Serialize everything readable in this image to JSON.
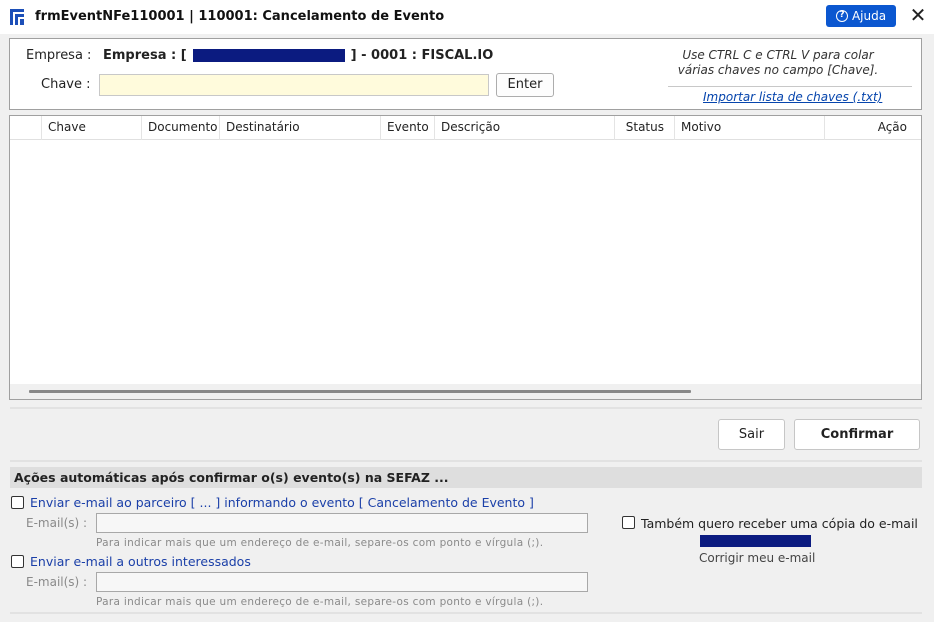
{
  "window": {
    "title": "frmEventNFe110001 | 110001: Cancelamento de Evento",
    "help_label": "Ajuda",
    "close_glyph": "✕"
  },
  "header": {
    "empresa_label": "Empresa :",
    "empresa_prefix": "Empresa : [",
    "empresa_suffix": "] - 0001 : FISCAL.IO",
    "chave_label": "Chave :",
    "chave_value": "",
    "enter_label": "Enter",
    "hint_text": "Use CTRL C e CTRL V para colar várias chaves no campo [Chave].",
    "import_link": "Importar lista de chaves (.txt)"
  },
  "grid": {
    "columns": [
      "Chave",
      "Documento",
      "Destinatário",
      "Evento",
      "Descrição",
      "Status",
      "Motivo",
      "Ação"
    ],
    "rows": []
  },
  "buttons": {
    "sair": "Sair",
    "confirmar": "Confirmar"
  },
  "actions": {
    "title": "Ações automáticas após confirmar o(s) evento(s) na SEFAZ ...",
    "partner_email_label": "Enviar e-mail ao parceiro [  ... ] informando o evento [ Cancelamento de Evento ]",
    "email_field_label": "E-mail(s) :",
    "email_hint": "Para indicar mais que um endereço de e-mail, separe-os com ponto e vírgula (;).",
    "others_email_label": "Enviar e-mail a outros interessados",
    "copy_label": "Também quero receber uma cópia do e-mail",
    "fix_email_label": "Corrigir meu e-mail"
  },
  "colors": {
    "accent": "#0b57d0",
    "redaction": "#0b1b80",
    "input_highlight": "#fffbdc"
  },
  "icons": {
    "app": "app-logo-icon",
    "help": "question-circle-icon",
    "close": "close-icon"
  }
}
